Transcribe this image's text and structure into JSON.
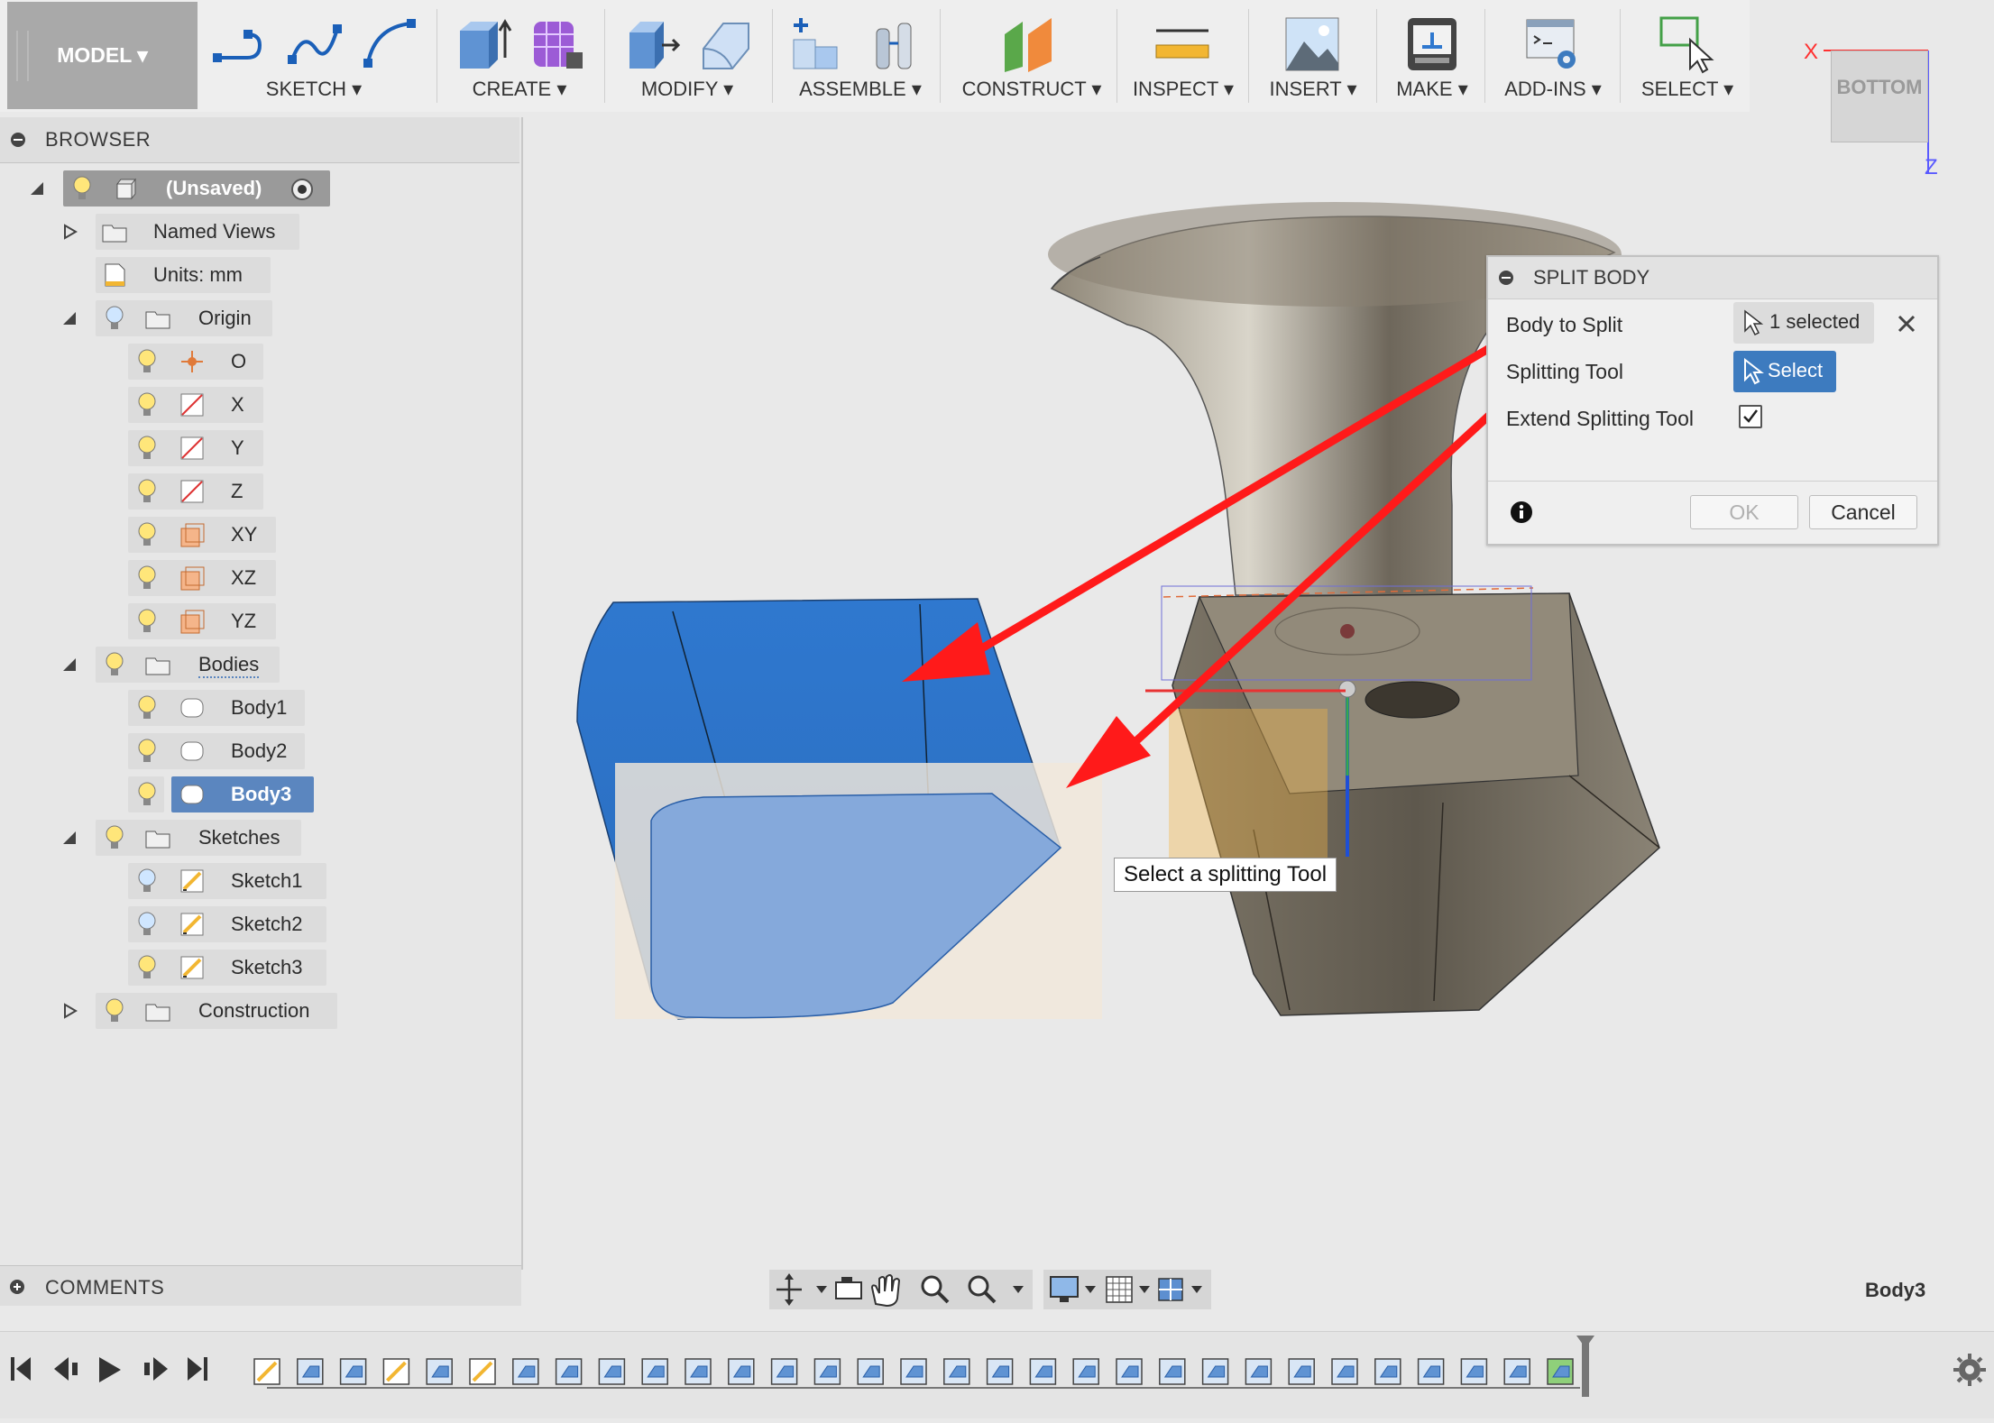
{
  "toolbar": {
    "workspace": "MODEL ▾",
    "groups": [
      {
        "label": "SKETCH ▾"
      },
      {
        "label": "CREATE ▾"
      },
      {
        "label": "MODIFY ▾"
      },
      {
        "label": "ASSEMBLE ▾"
      },
      {
        "label": "CONSTRUCT ▾"
      },
      {
        "label": "INSPECT ▾"
      },
      {
        "label": "INSERT ▾"
      },
      {
        "label": "MAKE ▾"
      },
      {
        "label": "ADD-INS ▾"
      },
      {
        "label": "SELECT ▾"
      }
    ]
  },
  "viewcube": {
    "face": "BOTTOM",
    "axis_x": "X",
    "axis_z": "Z"
  },
  "browser": {
    "title": "BROWSER",
    "root": "(Unsaved)",
    "items": [
      {
        "label": "Named Views"
      },
      {
        "label": "Units: mm"
      },
      {
        "label": "Origin"
      },
      {
        "label": "O"
      },
      {
        "label": "X"
      },
      {
        "label": "Y"
      },
      {
        "label": "Z"
      },
      {
        "label": "XY"
      },
      {
        "label": "XZ"
      },
      {
        "label": "YZ"
      },
      {
        "label": "Bodies"
      },
      {
        "label": "Body1"
      },
      {
        "label": "Body2"
      },
      {
        "label": "Body3"
      },
      {
        "label": "Sketches"
      },
      {
        "label": "Sketch1"
      },
      {
        "label": "Sketch2"
      },
      {
        "label": "Sketch3"
      },
      {
        "label": "Construction"
      }
    ]
  },
  "comments": {
    "title": "COMMENTS"
  },
  "dialog": {
    "title": "SPLIT BODY",
    "body_to_split_label": "Body to Split",
    "body_to_split_value": "1 selected",
    "splitting_tool_label": "Splitting Tool",
    "splitting_tool_button": "Select",
    "extend_label": "Extend Splitting Tool",
    "extend_checked": true,
    "ok": "OK",
    "cancel": "Cancel"
  },
  "tooltip": "Select a splitting Tool",
  "status": {
    "selected_body": "Body3"
  },
  "colors": {
    "accent": "#3d7bbf",
    "selection": "#5b86bf",
    "annotation": "#ff1a1a",
    "body_blue": "#2f78cf"
  }
}
